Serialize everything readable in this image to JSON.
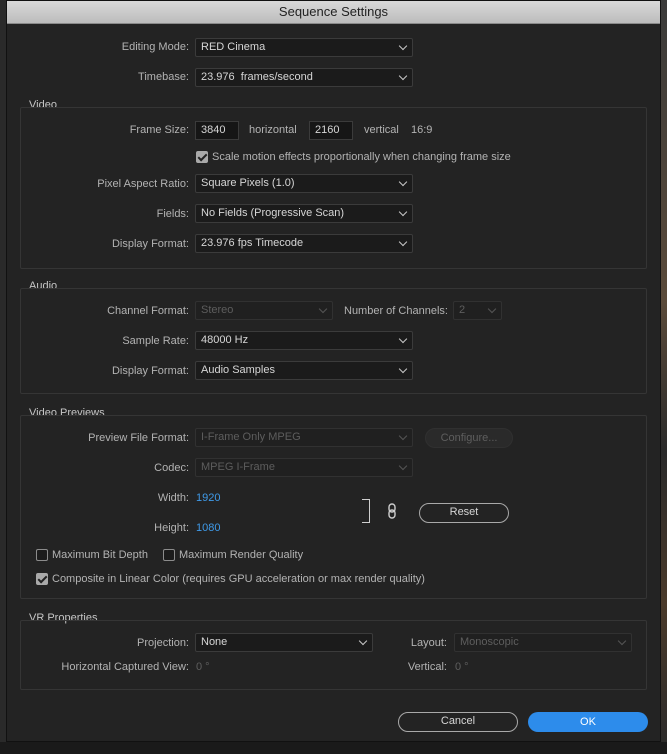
{
  "title": "Sequence Settings",
  "editing_mode": {
    "label": "Editing Mode:",
    "value": "RED Cinema"
  },
  "timebase": {
    "label": "Timebase:",
    "value": "23.976  frames/second"
  },
  "video": {
    "title": "Video",
    "frame_size_label": "Frame Size:",
    "frame_width": "3840",
    "horizontal_label": "horizontal",
    "frame_height": "2160",
    "vertical_label": "vertical",
    "aspect": "16:9",
    "scale_checkbox_label": "Scale motion effects proportionally when changing frame size",
    "pixel_aspect_label": "Pixel Aspect Ratio:",
    "pixel_aspect_value": "Square Pixels (1.0)",
    "fields_label": "Fields:",
    "fields_value": "No Fields (Progressive Scan)",
    "display_format_label": "Display Format:",
    "display_format_value": "23.976 fps Timecode"
  },
  "audio": {
    "title": "Audio",
    "channel_format_label": "Channel Format:",
    "channel_format_value": "Stereo",
    "num_channels_label": "Number of Channels:",
    "num_channels_value": "2",
    "sample_rate_label": "Sample Rate:",
    "sample_rate_value": "48000 Hz",
    "display_format_label": "Display Format:",
    "display_format_value": "Audio Samples"
  },
  "previews": {
    "title": "Video Previews",
    "file_format_label": "Preview File Format:",
    "file_format_value": "I-Frame Only MPEG",
    "configure_label": "Configure...",
    "codec_label": "Codec:",
    "codec_value": "MPEG I-Frame",
    "width_label": "Width:",
    "width_value": "1920",
    "height_label": "Height:",
    "height_value": "1080",
    "reset_label": "Reset",
    "max_bit_depth_label": "Maximum Bit Depth",
    "max_render_quality_label": "Maximum Render Quality",
    "composite_label": "Composite in Linear Color (requires GPU acceleration or max render quality)"
  },
  "vr": {
    "title": "VR Properties",
    "projection_label": "Projection:",
    "projection_value": "None",
    "layout_label": "Layout:",
    "layout_value": "Monoscopic",
    "hcv_label": "Horizontal Captured View:",
    "hcv_value": "0 °",
    "vertical_label": "Vertical:",
    "vertical_value": "0 °"
  },
  "buttons": {
    "cancel": "Cancel",
    "ok": "OK"
  },
  "colors": {
    "accent": "#2d8ceb",
    "link_blue": "#3f9ae8",
    "dialog_bg": "#232323"
  }
}
